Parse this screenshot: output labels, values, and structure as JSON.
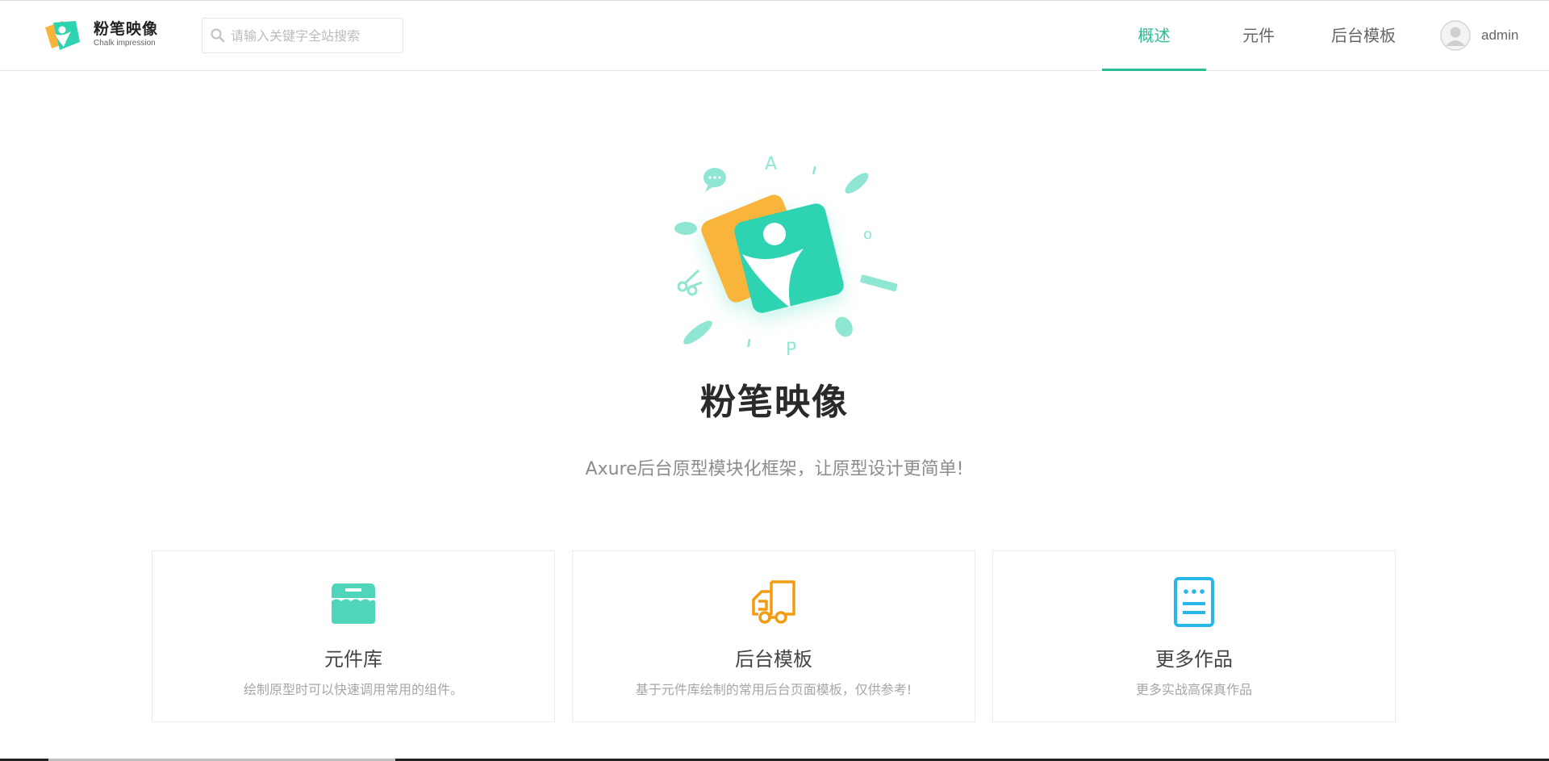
{
  "header": {
    "brand_name": "粉笔映像",
    "brand_sub": "Chalk impression",
    "search_placeholder": "请输入关键字全站搜索",
    "nav": [
      {
        "label": "概述",
        "active": true
      },
      {
        "label": "元件",
        "active": false
      },
      {
        "label": "后台模板",
        "active": false
      }
    ],
    "user": {
      "name": "admin"
    }
  },
  "hero": {
    "title": "粉笔映像",
    "subtitle": "Axure后台原型模块化框架，让原型设计更简单!",
    "decor_letters": [
      "A",
      "o",
      "P"
    ]
  },
  "cards": [
    {
      "title": "元件库",
      "desc": "绘制原型时可以快速调用常用的组件。",
      "icon": "store-icon",
      "color": "#4fd6ba"
    },
    {
      "title": "后台模板",
      "desc": "基于元件库绘制的常用后台页面模板，仅供参考!",
      "icon": "truck-icon",
      "color": "#f39c12"
    },
    {
      "title": "更多作品",
      "desc": "更多实战高保真作品",
      "icon": "document-icon",
      "color": "#29b6e8"
    }
  ],
  "colors": {
    "accent": "#2bbd94",
    "logo_orange": "#f9b43a",
    "logo_green": "#2ed3b2"
  }
}
